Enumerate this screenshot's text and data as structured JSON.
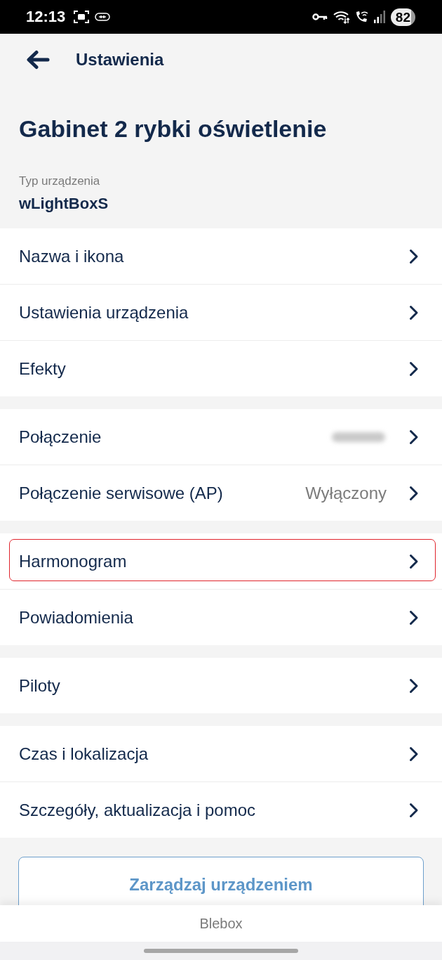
{
  "status_bar": {
    "time": "12:13",
    "battery": "82"
  },
  "header": {
    "title": "Ustawienia"
  },
  "device": {
    "name": "Gabinet 2 rybki oświetlenie",
    "type_label": "Typ urządzenia",
    "type_value": "wLightBoxS"
  },
  "groups": [
    {
      "items": [
        {
          "label": "Nazwa i ikona",
          "value_blurred": false,
          "highlighted": false
        },
        {
          "label": "Ustawienia urządzenia",
          "value_blurred": false,
          "highlighted": false
        },
        {
          "label": "Efekty",
          "value_blurred": false,
          "highlighted": false
        }
      ]
    },
    {
      "items": [
        {
          "label": "Połączenie",
          "value_blurred": true,
          "highlighted": false
        },
        {
          "label": "Połączenie serwisowe (AP)",
          "value": "Wyłączony",
          "value_blurred": false,
          "highlighted": false
        }
      ]
    },
    {
      "items": [
        {
          "label": "Harmonogram",
          "value_blurred": false,
          "highlighted": true
        },
        {
          "label": "Powiadomienia",
          "value_blurred": false,
          "highlighted": false
        }
      ]
    },
    {
      "items": [
        {
          "label": "Piloty",
          "value_blurred": false,
          "highlighted": false
        }
      ]
    },
    {
      "items": [
        {
          "label": "Czas i lokalizacja",
          "value_blurred": false,
          "highlighted": false
        },
        {
          "label": "Szczegóły, aktualizacja i pomoc",
          "value_blurred": false,
          "highlighted": false
        }
      ]
    }
  ],
  "action_button": "Zarządzaj urządzeniem",
  "footer": "Blebox"
}
